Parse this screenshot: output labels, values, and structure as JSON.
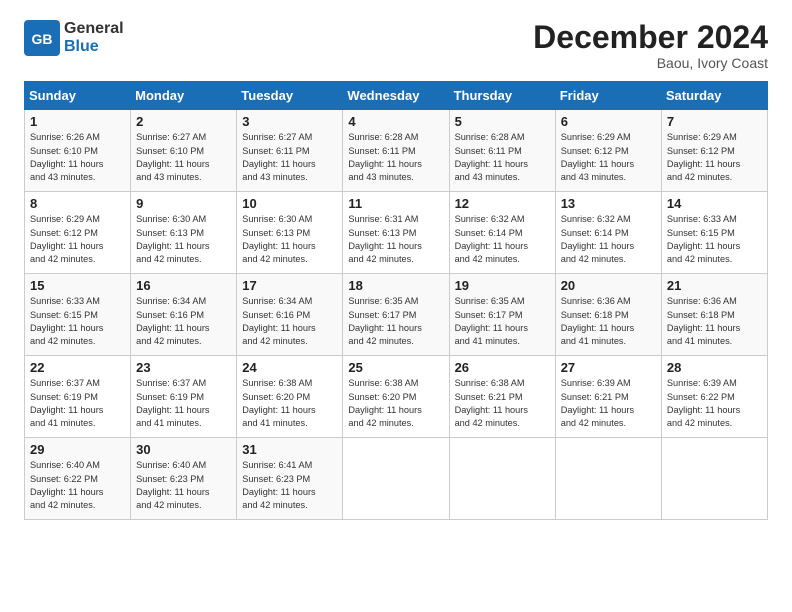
{
  "header": {
    "logo_general": "General",
    "logo_blue": "Blue",
    "month_title": "December 2024",
    "location": "Baou, Ivory Coast"
  },
  "days_of_week": [
    "Sunday",
    "Monday",
    "Tuesday",
    "Wednesday",
    "Thursday",
    "Friday",
    "Saturday"
  ],
  "weeks": [
    [
      {
        "day": 1,
        "lines": [
          "Sunrise: 6:26 AM",
          "Sunset: 6:10 PM",
          "Daylight: 11 hours",
          "and 43 minutes."
        ]
      },
      {
        "day": 2,
        "lines": [
          "Sunrise: 6:27 AM",
          "Sunset: 6:10 PM",
          "Daylight: 11 hours",
          "and 43 minutes."
        ]
      },
      {
        "day": 3,
        "lines": [
          "Sunrise: 6:27 AM",
          "Sunset: 6:11 PM",
          "Daylight: 11 hours",
          "and 43 minutes."
        ]
      },
      {
        "day": 4,
        "lines": [
          "Sunrise: 6:28 AM",
          "Sunset: 6:11 PM",
          "Daylight: 11 hours",
          "and 43 minutes."
        ]
      },
      {
        "day": 5,
        "lines": [
          "Sunrise: 6:28 AM",
          "Sunset: 6:11 PM",
          "Daylight: 11 hours",
          "and 43 minutes."
        ]
      },
      {
        "day": 6,
        "lines": [
          "Sunrise: 6:29 AM",
          "Sunset: 6:12 PM",
          "Daylight: 11 hours",
          "and 43 minutes."
        ]
      },
      {
        "day": 7,
        "lines": [
          "Sunrise: 6:29 AM",
          "Sunset: 6:12 PM",
          "Daylight: 11 hours",
          "and 42 minutes."
        ]
      }
    ],
    [
      {
        "day": 8,
        "lines": [
          "Sunrise: 6:29 AM",
          "Sunset: 6:12 PM",
          "Daylight: 11 hours",
          "and 42 minutes."
        ]
      },
      {
        "day": 9,
        "lines": [
          "Sunrise: 6:30 AM",
          "Sunset: 6:13 PM",
          "Daylight: 11 hours",
          "and 42 minutes."
        ]
      },
      {
        "day": 10,
        "lines": [
          "Sunrise: 6:30 AM",
          "Sunset: 6:13 PM",
          "Daylight: 11 hours",
          "and 42 minutes."
        ]
      },
      {
        "day": 11,
        "lines": [
          "Sunrise: 6:31 AM",
          "Sunset: 6:13 PM",
          "Daylight: 11 hours",
          "and 42 minutes."
        ]
      },
      {
        "day": 12,
        "lines": [
          "Sunrise: 6:32 AM",
          "Sunset: 6:14 PM",
          "Daylight: 11 hours",
          "and 42 minutes."
        ]
      },
      {
        "day": 13,
        "lines": [
          "Sunrise: 6:32 AM",
          "Sunset: 6:14 PM",
          "Daylight: 11 hours",
          "and 42 minutes."
        ]
      },
      {
        "day": 14,
        "lines": [
          "Sunrise: 6:33 AM",
          "Sunset: 6:15 PM",
          "Daylight: 11 hours",
          "and 42 minutes."
        ]
      }
    ],
    [
      {
        "day": 15,
        "lines": [
          "Sunrise: 6:33 AM",
          "Sunset: 6:15 PM",
          "Daylight: 11 hours",
          "and 42 minutes."
        ]
      },
      {
        "day": 16,
        "lines": [
          "Sunrise: 6:34 AM",
          "Sunset: 6:16 PM",
          "Daylight: 11 hours",
          "and 42 minutes."
        ]
      },
      {
        "day": 17,
        "lines": [
          "Sunrise: 6:34 AM",
          "Sunset: 6:16 PM",
          "Daylight: 11 hours",
          "and 42 minutes."
        ]
      },
      {
        "day": 18,
        "lines": [
          "Sunrise: 6:35 AM",
          "Sunset: 6:17 PM",
          "Daylight: 11 hours",
          "and 42 minutes."
        ]
      },
      {
        "day": 19,
        "lines": [
          "Sunrise: 6:35 AM",
          "Sunset: 6:17 PM",
          "Daylight: 11 hours",
          "and 41 minutes."
        ]
      },
      {
        "day": 20,
        "lines": [
          "Sunrise: 6:36 AM",
          "Sunset: 6:18 PM",
          "Daylight: 11 hours",
          "and 41 minutes."
        ]
      },
      {
        "day": 21,
        "lines": [
          "Sunrise: 6:36 AM",
          "Sunset: 6:18 PM",
          "Daylight: 11 hours",
          "and 41 minutes."
        ]
      }
    ],
    [
      {
        "day": 22,
        "lines": [
          "Sunrise: 6:37 AM",
          "Sunset: 6:19 PM",
          "Daylight: 11 hours",
          "and 41 minutes."
        ]
      },
      {
        "day": 23,
        "lines": [
          "Sunrise: 6:37 AM",
          "Sunset: 6:19 PM",
          "Daylight: 11 hours",
          "and 41 minutes."
        ]
      },
      {
        "day": 24,
        "lines": [
          "Sunrise: 6:38 AM",
          "Sunset: 6:20 PM",
          "Daylight: 11 hours",
          "and 41 minutes."
        ]
      },
      {
        "day": 25,
        "lines": [
          "Sunrise: 6:38 AM",
          "Sunset: 6:20 PM",
          "Daylight: 11 hours",
          "and 42 minutes."
        ]
      },
      {
        "day": 26,
        "lines": [
          "Sunrise: 6:38 AM",
          "Sunset: 6:21 PM",
          "Daylight: 11 hours",
          "and 42 minutes."
        ]
      },
      {
        "day": 27,
        "lines": [
          "Sunrise: 6:39 AM",
          "Sunset: 6:21 PM",
          "Daylight: 11 hours",
          "and 42 minutes."
        ]
      },
      {
        "day": 28,
        "lines": [
          "Sunrise: 6:39 AM",
          "Sunset: 6:22 PM",
          "Daylight: 11 hours",
          "and 42 minutes."
        ]
      }
    ],
    [
      {
        "day": 29,
        "lines": [
          "Sunrise: 6:40 AM",
          "Sunset: 6:22 PM",
          "Daylight: 11 hours",
          "and 42 minutes."
        ]
      },
      {
        "day": 30,
        "lines": [
          "Sunrise: 6:40 AM",
          "Sunset: 6:23 PM",
          "Daylight: 11 hours",
          "and 42 minutes."
        ]
      },
      {
        "day": 31,
        "lines": [
          "Sunrise: 6:41 AM",
          "Sunset: 6:23 PM",
          "Daylight: 11 hours",
          "and 42 minutes."
        ]
      },
      null,
      null,
      null,
      null
    ]
  ]
}
